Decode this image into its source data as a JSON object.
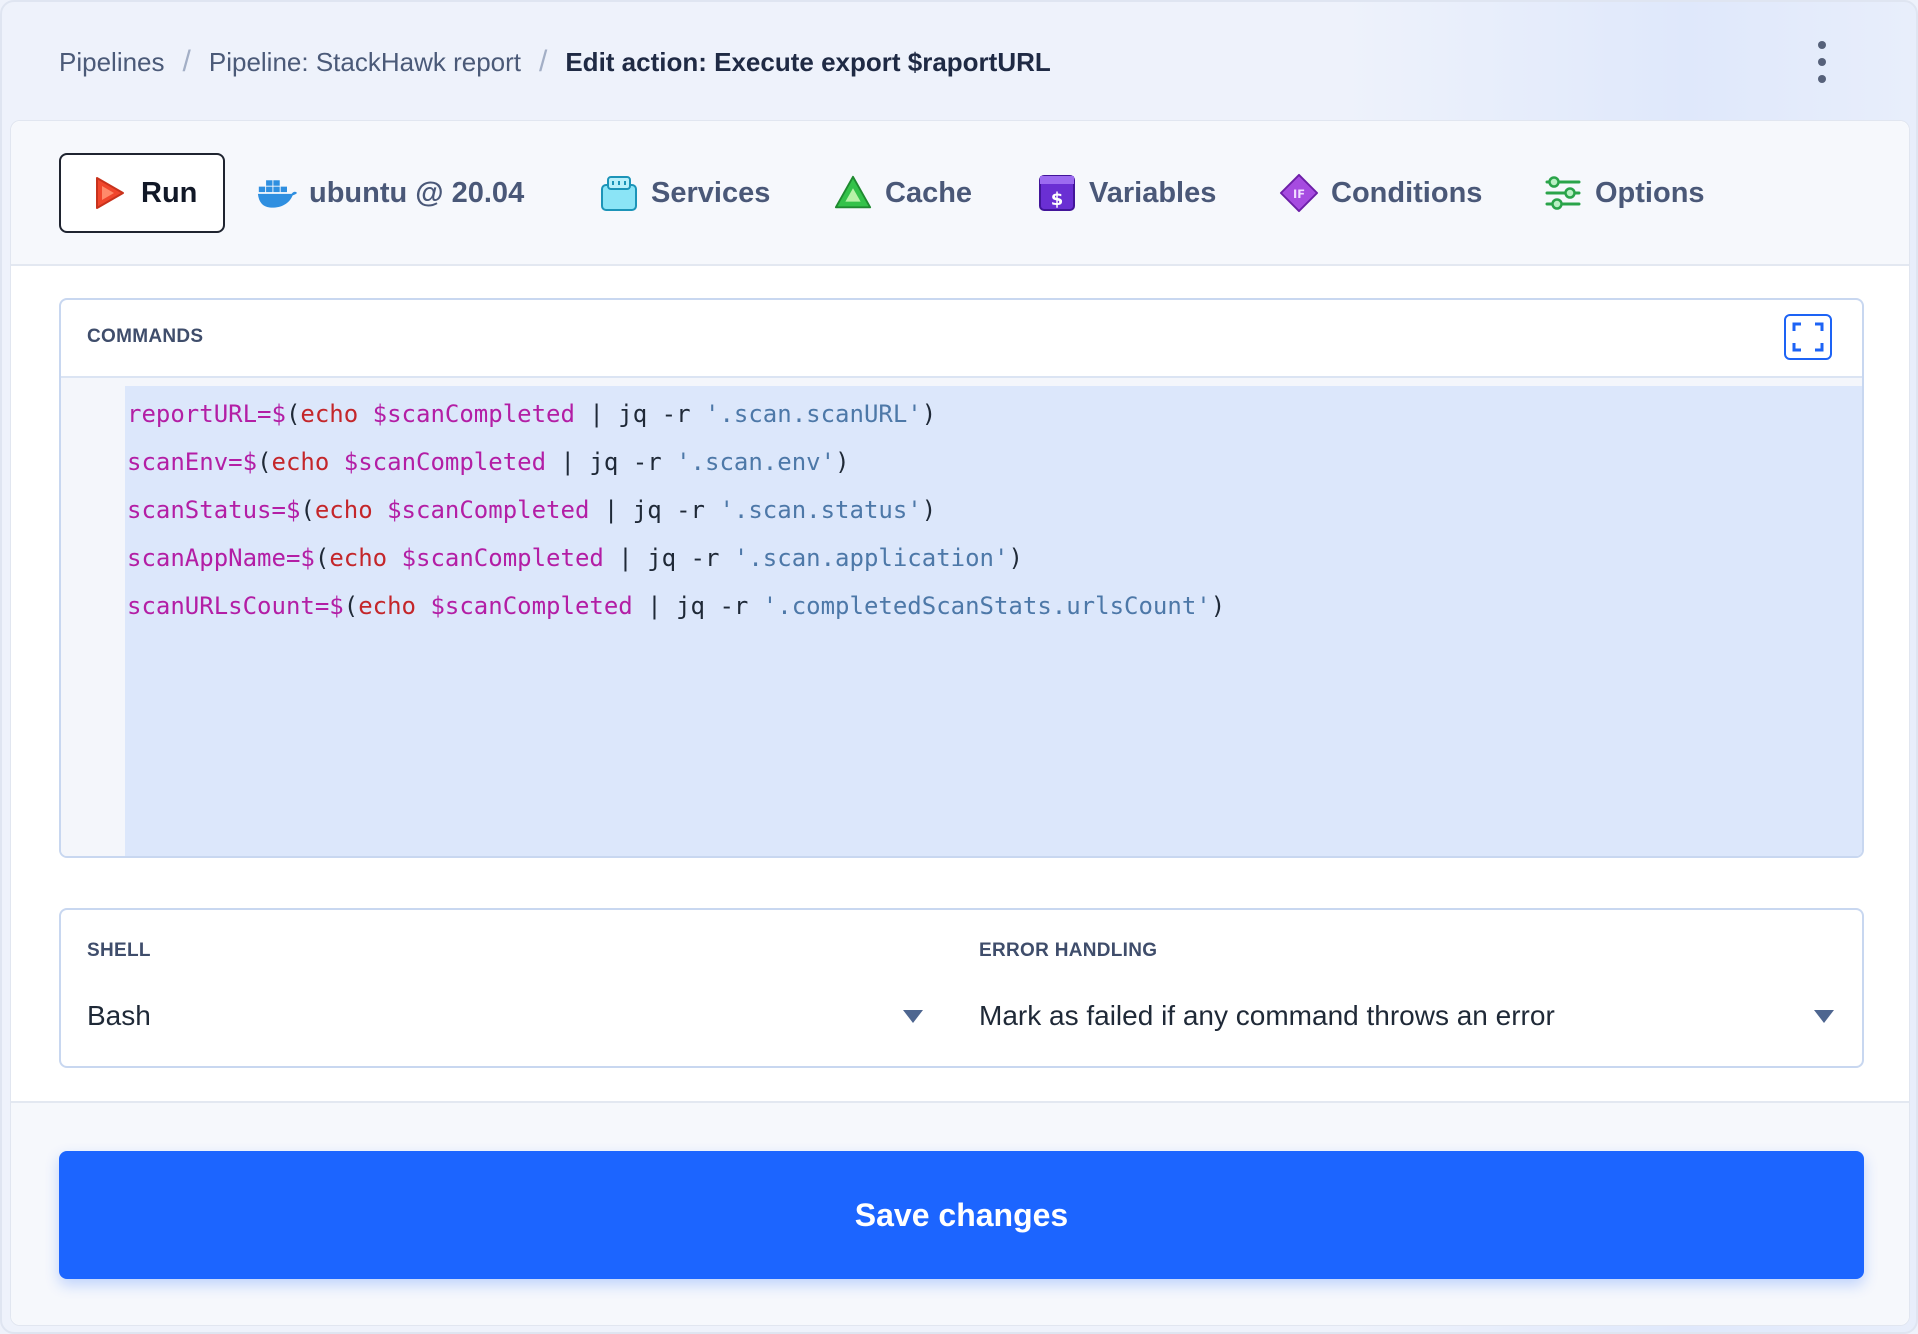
{
  "breadcrumb": {
    "items": [
      "Pipelines",
      "Pipeline: StackHawk report"
    ],
    "separator": "/",
    "current": "Edit action: Execute export $raportURL"
  },
  "tabs": {
    "run": {
      "label": "Run",
      "icon": "play-icon",
      "color": "#f0462c"
    },
    "image": {
      "label": "ubuntu @ 20.04",
      "icon": "docker-whale-icon",
      "color": "#2f8fe0"
    },
    "services": {
      "label": "Services",
      "icon": "container-box-icon",
      "color": "#5fd3ef"
    },
    "cache": {
      "label": "Cache",
      "icon": "triangle-cache-icon",
      "color": "#34c24a"
    },
    "variables": {
      "label": "Variables",
      "icon": "dollar-badge-icon",
      "color": "#6a2fd3"
    },
    "conditions": {
      "label": "Conditions",
      "icon": "if-diamond-icon",
      "color": "#a64be0"
    },
    "options": {
      "label": "Options",
      "icon": "sliders-icon",
      "color": "#2aa44a"
    }
  },
  "commands": {
    "label": "COMMANDS",
    "expand_icon": "fullscreen-icon",
    "lines": [
      {
        "var": "reportURL",
        "op": "=$",
        "open": "(",
        "cmd": "echo",
        "arg": "$scanCompleted",
        "pipe": " | jq -r ",
        "str": "'.scan.scanURL'",
        "close": ")"
      },
      {
        "var": "scanEnv",
        "op": "=$",
        "open": "(",
        "cmd": "echo",
        "arg": "$scanCompleted",
        "pipe": " | jq -r ",
        "str": "'.scan.env'",
        "close": ")"
      },
      {
        "var": "scanStatus",
        "op": "=$",
        "open": "(",
        "cmd": "echo",
        "arg": "$scanCompleted",
        "pipe": " | jq -r ",
        "str": "'.scan.status'",
        "close": ")"
      },
      {
        "var": "scanAppName",
        "op": "=$",
        "open": "(",
        "cmd": "echo",
        "arg": "$scanCompleted",
        "pipe": " | jq -r ",
        "str": "'.scan.application'",
        "close": ")"
      },
      {
        "var": "scanURLsCount",
        "op": "=$",
        "open": "(",
        "cmd": "echo",
        "arg": "$scanCompleted",
        "pipe": " | jq -r ",
        "str": "'.completedScanStats.urlsCount'",
        "close": ")"
      }
    ]
  },
  "shell": {
    "label": "SHELL",
    "value": "Bash"
  },
  "error_handling": {
    "label": "ERROR HANDLING",
    "value": "Mark as failed if any command throws an error"
  },
  "save_button": {
    "label": "Save changes",
    "color": "#1c65ff"
  }
}
